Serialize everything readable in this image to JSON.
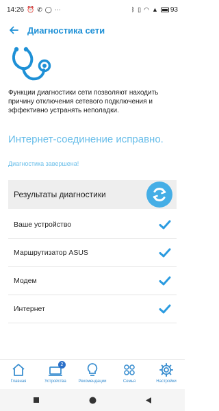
{
  "status_bar": {
    "time": "14:26",
    "left_icons": [
      "alarm-icon",
      "missed-call-icon",
      "whatsapp-icon",
      "more-dots-icon"
    ],
    "right_icons": [
      "bluetooth-icon",
      "vibrate-icon",
      "wifi-icon",
      "signal-icon"
    ],
    "battery": "93"
  },
  "header": {
    "title": "Диагностика сети",
    "back_icon": "back-arrow-icon"
  },
  "description": "Функции диагностики сети позволяют находить причину отключения сетевого подключения и эффективно устранять неполадки.",
  "status": {
    "title": "Интернет-соединение исправно.",
    "subtitle": "Диагностика завершена!"
  },
  "results": {
    "title": "Результаты диагностики",
    "items": [
      {
        "label": "Ваше устройство",
        "status_icon": "check-icon"
      },
      {
        "label": "Маршрутизатор ASUS",
        "status_icon": "check-icon"
      },
      {
        "label": "Модем",
        "status_icon": "check-icon"
      },
      {
        "label": "Интернет",
        "status_icon": "check-icon"
      }
    ]
  },
  "bottom_nav": {
    "items": [
      {
        "label": "Главная",
        "icon": "home-icon"
      },
      {
        "label": "Устройства",
        "icon": "devices-icon",
        "badge": "2"
      },
      {
        "label": "Рекомендации",
        "icon": "lightbulb-icon"
      },
      {
        "label": "Семья",
        "icon": "family-icon"
      },
      {
        "label": "Настройки",
        "icon": "gear-icon"
      }
    ]
  },
  "colors": {
    "accent": "#1e90d6",
    "status_text": "#67bde9",
    "refresh": "#45aee6",
    "check": "#2b9be0"
  }
}
